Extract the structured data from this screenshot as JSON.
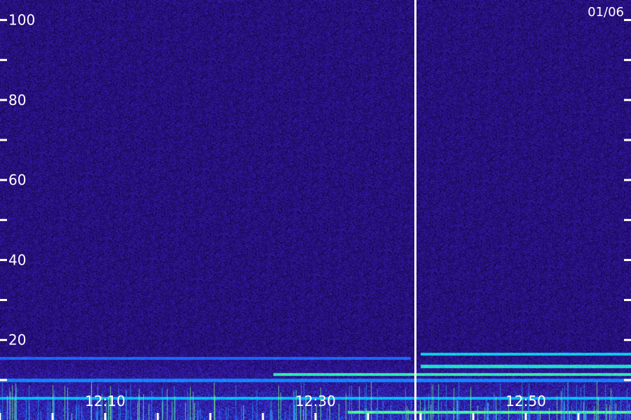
{
  "chart_data": {
    "type": "heatmap",
    "title": "",
    "date_label": "01/06",
    "xlabel": "",
    "ylabel": "",
    "x_range": [
      "12:00",
      "13:00"
    ],
    "y_range": [
      0,
      105
    ],
    "y_ticks_labeled": [
      {
        "value": 100,
        "label": "100"
      },
      {
        "value": 80,
        "label": "80"
      },
      {
        "value": 60,
        "label": "60"
      },
      {
        "value": 40,
        "label": "40"
      },
      {
        "value": 20,
        "label": "20"
      }
    ],
    "y_ticks_minor": [
      90,
      70,
      50,
      30,
      10
    ],
    "x_ticks_labeled": [
      {
        "value": "12:10",
        "label": "12:10"
      },
      {
        "value": "12:30",
        "label": "12:30"
      },
      {
        "value": "12:50",
        "label": "12:50"
      }
    ],
    "x_ticks_minor": [
      "12:00",
      "12:05",
      "12:15",
      "12:20",
      "12:25",
      "12:35",
      "12:40",
      "12:45",
      "12:55"
    ],
    "marker_time": "12:39.5",
    "colormap": [
      "#000000",
      "#1a0a5e",
      "#3a1ab0",
      "#2060ff",
      "#00c8ff",
      "#40ff90",
      "#ffff40"
    ],
    "background_color": "#24106e",
    "bands": [
      {
        "freq": 15.5,
        "from": "12:00",
        "to": "12:39",
        "level": 0.55
      },
      {
        "freq": 11.5,
        "from": "12:26",
        "to": "13:00",
        "level": 0.85
      },
      {
        "freq": 13.5,
        "from": "12:40",
        "to": "13:00",
        "level": 0.8
      },
      {
        "freq": 16.5,
        "from": "12:40",
        "to": "13:00",
        "level": 0.75
      },
      {
        "freq": 10,
        "from": "12:00",
        "to": "13:00",
        "level": 0.6
      },
      {
        "freq": 5.5,
        "from": "12:00",
        "to": "13:00",
        "level": 0.7
      },
      {
        "freq": 2,
        "from": "12:33",
        "to": "13:00",
        "level": 0.9
      }
    ]
  }
}
